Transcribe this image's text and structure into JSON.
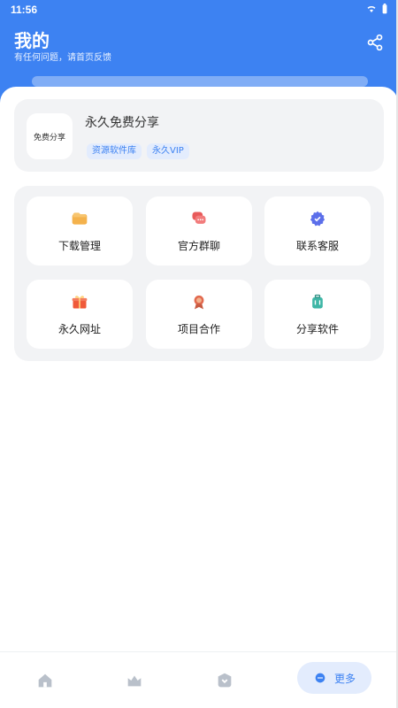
{
  "status_bar": {
    "time": "11:56"
  },
  "header": {
    "title": "我的",
    "subtitle": "有任何问题，请首页反馈",
    "share_icon": "share-icon"
  },
  "profile": {
    "logo_text": "免费分享",
    "name": "永久免费分享",
    "tags": [
      "资源软件库",
      "永久VIP"
    ]
  },
  "grid": {
    "items": [
      {
        "label": "下载管理",
        "icon": "folder-icon",
        "color": "#F4B24C"
      },
      {
        "label": "官方群聊",
        "icon": "chat-icon",
        "color": "#E85A5A"
      },
      {
        "label": "联系客服",
        "icon": "verified-badge-icon",
        "color": "#5C6FEA"
      },
      {
        "label": "永久网址",
        "icon": "gift-icon",
        "color": "#F05A3A"
      },
      {
        "label": "项目合作",
        "icon": "award-icon",
        "color": "#E2694E"
      },
      {
        "label": "分享软件",
        "icon": "luggage-icon",
        "color": "#3FB6A6"
      }
    ]
  },
  "bottom_nav": {
    "items": [
      "home-icon",
      "crown-icon",
      "shop-icon"
    ],
    "active": {
      "label": "更多",
      "icon": "more-icon"
    }
  },
  "colors": {
    "accent": "#3D82F2",
    "card_bg": "#F2F3F5",
    "tag_bg": "#E3ECFD"
  }
}
